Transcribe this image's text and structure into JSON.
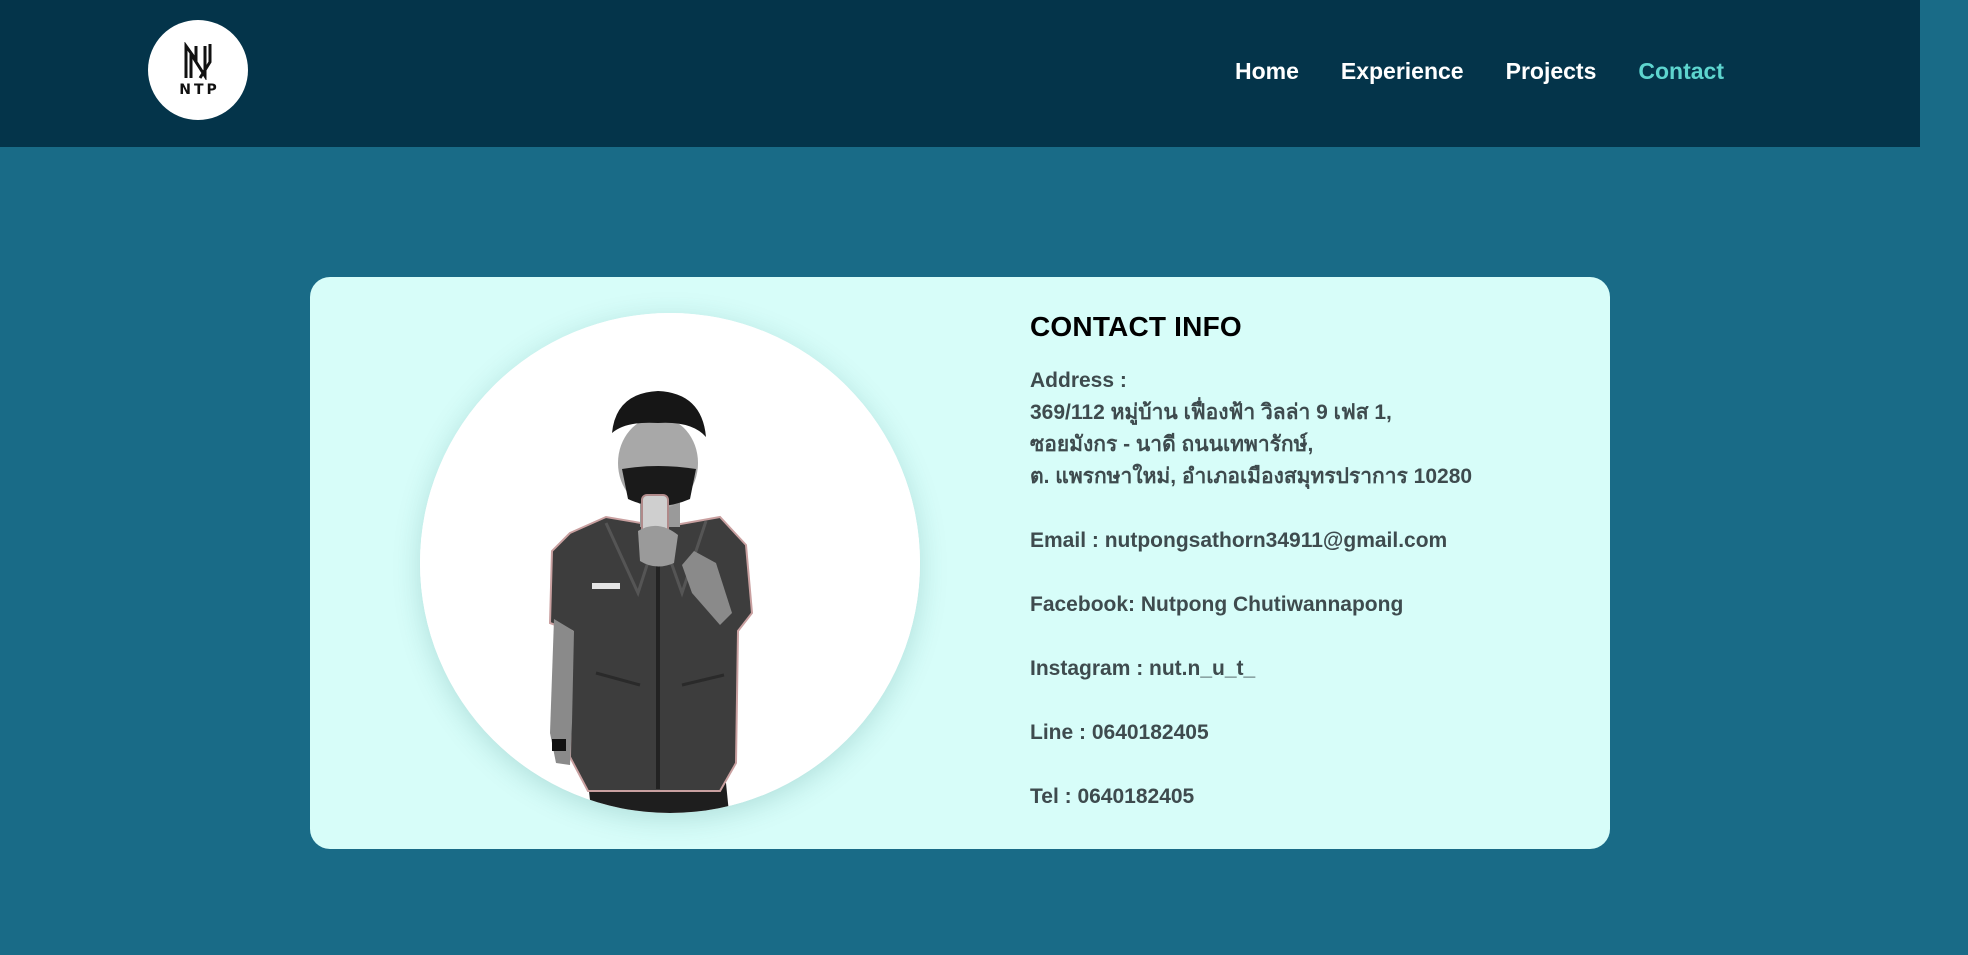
{
  "header": {
    "logo_text": "NTP",
    "nav": [
      {
        "label": "Home",
        "active": false
      },
      {
        "label": "Experience",
        "active": false
      },
      {
        "label": "Projects",
        "active": false
      },
      {
        "label": "Contact",
        "active": true
      }
    ]
  },
  "contact": {
    "title": "CONTACT INFO",
    "address_label": "Address :",
    "address_lines": [
      "369/112 หมู่บ้าน เฟื่องฟ้า วิลล่า 9 เฟส 1,",
      "ซอยมังกร - นาดี ถนนเทพารักษ์,",
      "ต. แพรกษาใหม่, อำเภอเมืองสมุทรปราการ 10280"
    ],
    "email": "Email : nutpongsathorn34911@gmail.com",
    "facebook": "Facebook: Nutpong Chutiwannapong",
    "instagram": "Instagram : nut.n_u_t_",
    "line": "Line : 0640182405",
    "tel": "Tel : 0640182405"
  },
  "colors": {
    "page_bg": "#196b87",
    "navbar_bg": "#04344a",
    "nav_active": "#5ed5cf",
    "card_bg": "#d7fdf9",
    "text_muted": "#3e4b4e"
  },
  "icons": {
    "logo": "ntp-logo-icon",
    "photo": "profile-photo"
  }
}
